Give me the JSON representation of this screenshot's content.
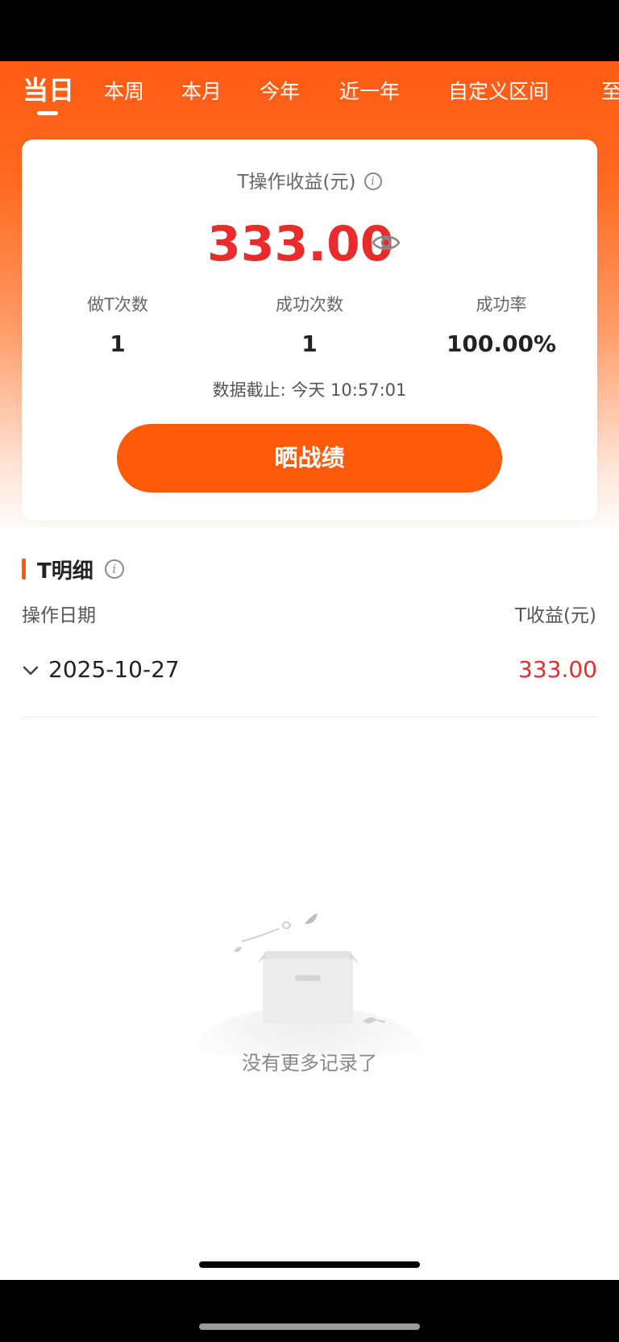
{
  "tabs": [
    {
      "label": "当日",
      "active": true
    },
    {
      "label": "本周",
      "active": false
    },
    {
      "label": "本月",
      "active": false
    },
    {
      "label": "今年",
      "active": false
    },
    {
      "label": "近一年",
      "active": false
    },
    {
      "label": "自定义区间",
      "active": false
    },
    {
      "label": "至",
      "active": false
    }
  ],
  "summary": {
    "profit_label": "T操作收益(元)",
    "profit_value": "333.00",
    "stats": [
      {
        "label": "做T次数",
        "value": "1"
      },
      {
        "label": "成功次数",
        "value": "1"
      },
      {
        "label": "成功率",
        "value": "100.00%"
      }
    ],
    "cutoff": "数据截止: 今天 10:57:01",
    "share_label": "晒战绩"
  },
  "detail": {
    "title": "T明细",
    "col_date": "操作日期",
    "col_profit": "T收益(元)",
    "rows": [
      {
        "date": "2025-10-27",
        "profit": "333.00"
      }
    ],
    "empty_text": "没有更多记录了"
  },
  "colors": {
    "brand_orange": "#ff5a0a",
    "profit_red": "#e82b2b"
  },
  "icons": {
    "info": "info-icon",
    "visibility": "eye-icon",
    "expand": "chevron-down-icon",
    "empty": "empty-box-illustration"
  }
}
